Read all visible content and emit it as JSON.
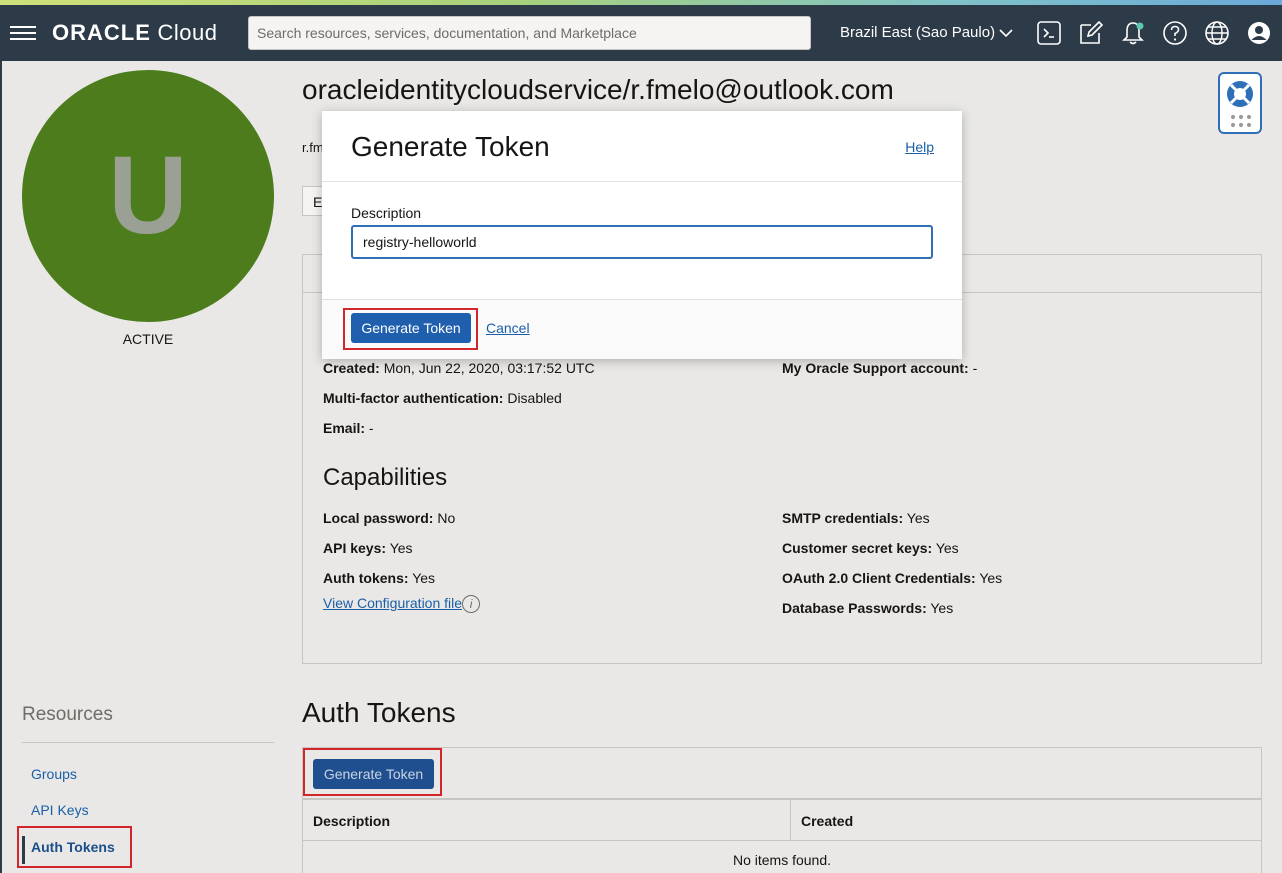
{
  "header": {
    "logo_brand": "ORACLE",
    "logo_product": "Cloud",
    "search_placeholder": "Search resources, services, documentation, and Marketplace",
    "region": "Brazil East (Sao Paulo)",
    "icons": [
      "cloud-shell-icon",
      "edit-icon",
      "bell-icon",
      "help-icon",
      "globe-icon",
      "profile-icon"
    ]
  },
  "profile": {
    "avatar_letter": "U",
    "status": "ACTIVE",
    "title": "oracleidentitycloudservice/r.fmelo@outlook.com",
    "subtitle_partial": "r.fm",
    "button_partial": "E"
  },
  "details": {
    "created_label": "Created:",
    "created_value": "Mon, Jun 22, 2020, 03:17:52 UTC",
    "support_label": "My Oracle Support account:",
    "support_value": "-",
    "mfa_label": "Multi-factor authentication:",
    "mfa_value": "Disabled",
    "email_label": "Email:",
    "email_value": "-"
  },
  "capabilities": {
    "title": "Capabilities",
    "items_left": [
      {
        "label": "Local password:",
        "value": "No"
      },
      {
        "label": "API keys:",
        "value": "Yes"
      },
      {
        "label": "Auth tokens:",
        "value": "Yes"
      }
    ],
    "items_right": [
      {
        "label": "SMTP credentials:",
        "value": "Yes"
      },
      {
        "label": "Customer secret keys:",
        "value": "Yes"
      },
      {
        "label": "OAuth 2.0 Client Credentials:",
        "value": "Yes"
      },
      {
        "label": "Database Passwords:",
        "value": "Yes"
      }
    ],
    "view_config_link": "View Configuration file"
  },
  "resources": {
    "title": "Resources",
    "links": [
      "Groups",
      "API Keys",
      "Auth Tokens"
    ],
    "active": "Auth Tokens"
  },
  "auth_tokens": {
    "title": "Auth Tokens",
    "generate_button": "Generate Token",
    "columns": [
      "Description",
      "Created"
    ],
    "empty_message": "No items found."
  },
  "modal": {
    "title": "Generate Token",
    "help_link": "Help",
    "description_label": "Description",
    "description_value": "registry-helloworld",
    "submit_button": "Generate Token",
    "cancel_link": "Cancel"
  },
  "colors": {
    "header_bg": "#2d3a47",
    "avatar_bg": "#4d7c1d",
    "primary_button": "#1f5fae",
    "highlight": "#d3262a",
    "link": "#1a5fa8"
  }
}
